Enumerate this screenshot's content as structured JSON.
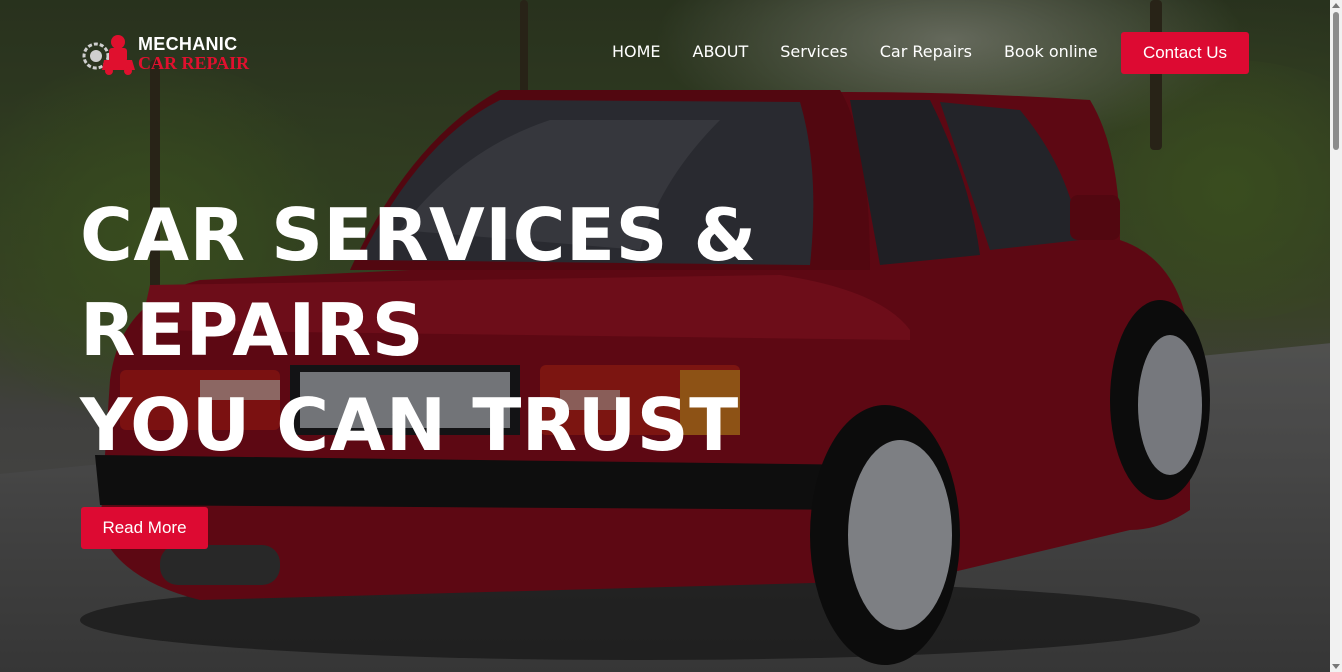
{
  "logo": {
    "line1": "MECHANIC",
    "line2": "CAR REPAIR",
    "icon": "mechanic-gear-car-icon"
  },
  "nav": {
    "items": [
      {
        "label": "HOME"
      },
      {
        "label": "ABOUT"
      },
      {
        "label": "Services"
      },
      {
        "label": "Car Repairs"
      },
      {
        "label": "Book online"
      }
    ],
    "contact_label": "Contact Us"
  },
  "hero": {
    "title_lines": [
      "CAR SERVICES &",
      "REPAIRS",
      "YOU CAN TRUST"
    ],
    "cta_label": "Read More"
  },
  "colors": {
    "accent": "#dd0a32",
    "logo_red": "#e0102e",
    "text": "#ffffff"
  }
}
